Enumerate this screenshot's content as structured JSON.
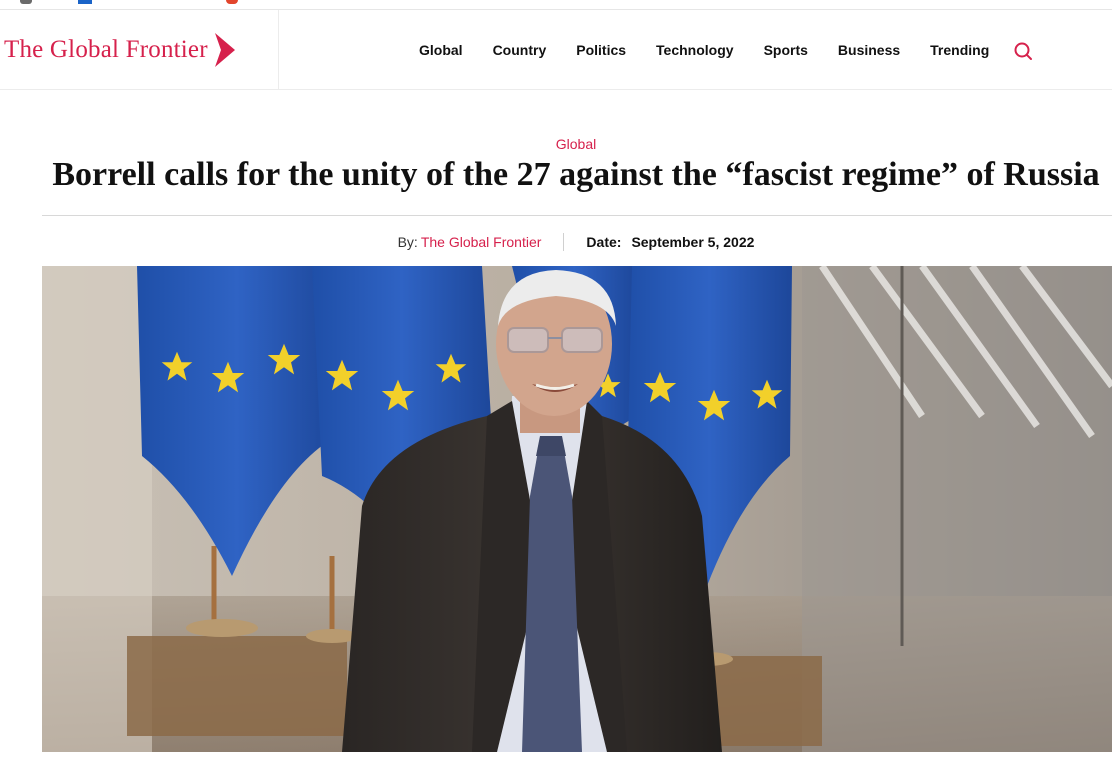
{
  "site": {
    "name": "The Global Frontier",
    "brand_color": "#d6214c"
  },
  "nav": {
    "items": [
      "Global",
      "Country",
      "Politics",
      "Technology",
      "Sports",
      "Business",
      "Trending"
    ],
    "search_icon": "search-icon"
  },
  "article": {
    "category": "Global",
    "title": "Borrell calls for the unity of the 27 against the “fascist regime” of Russia",
    "by_label": "By:",
    "author": "The Global Frontier",
    "date_label": "Date:",
    "date": "September 5, 2022"
  }
}
